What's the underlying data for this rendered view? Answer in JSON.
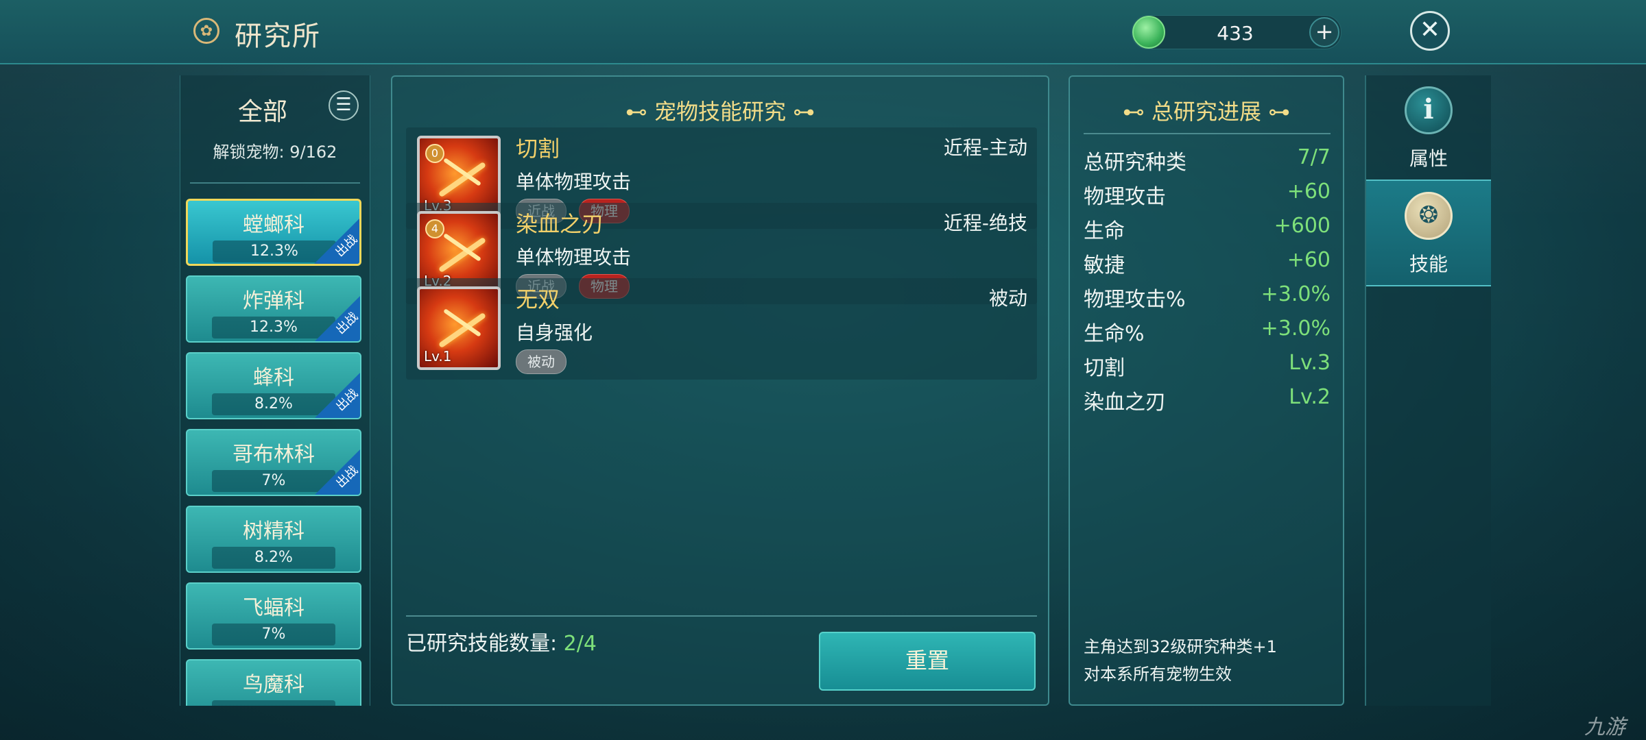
{
  "header": {
    "title": "研究所",
    "title_icon": "emblem-icon",
    "currency_value": "433",
    "plus_label": "+",
    "close_label": "✕"
  },
  "sidebar": {
    "filter_label": "全部",
    "menu_label": "☰",
    "unlock_text": "解锁宠物: 9/162",
    "categories": [
      {
        "name": "螳螂科",
        "percent": "12.3%",
        "badge": "出战",
        "selected": true
      },
      {
        "name": "炸弹科",
        "percent": "12.3%",
        "badge": "出战"
      },
      {
        "name": "蜂科",
        "percent": "8.2%",
        "badge": "出战"
      },
      {
        "name": "哥布林科",
        "percent": "7%",
        "badge": "出战"
      },
      {
        "name": "树精科",
        "percent": "8.2%"
      },
      {
        "name": "飞蝠科",
        "percent": "7%"
      },
      {
        "name": "鸟魔科",
        "percent": ""
      }
    ]
  },
  "center": {
    "title": "宠物技能研究",
    "skills": [
      {
        "name": "切割",
        "type": "近程-主动",
        "desc": "单体物理攻击",
        "level": "Lv.3",
        "num": "0",
        "tags": [
          "近战",
          "物理"
        ]
      },
      {
        "name": "染血之刃",
        "type": "近程-绝技",
        "desc": "单体物理攻击",
        "level": "Lv.2",
        "num": "4",
        "tags": [
          "近战",
          "物理"
        ]
      },
      {
        "name": "无双",
        "type": "被动",
        "desc": "自身强化",
        "level": "Lv.1",
        "num": "",
        "tags": [
          "被动"
        ]
      }
    ],
    "count_label": "已研究技能数量: ",
    "count_value": "2/4",
    "reset_label": "重置"
  },
  "progress": {
    "title": "总研究进展",
    "stats": [
      {
        "label": "总研究种类",
        "value": "7/7"
      },
      {
        "label": "物理攻击",
        "value": "+60"
      },
      {
        "label": "生命",
        "value": "+600"
      },
      {
        "label": "敏捷",
        "value": "+60"
      },
      {
        "label": "物理攻击%",
        "value": "+3.0%"
      },
      {
        "label": "生命%",
        "value": "+3.0%"
      },
      {
        "label": "切割",
        "value": "Lv.3"
      },
      {
        "label": "染血之刃",
        "value": "Lv.2"
      }
    ],
    "note_1": "主角达到32级研究种类+1",
    "note_2": "对本系所有宠物生效"
  },
  "tabs": [
    {
      "label": "属性",
      "icon": "info-icon",
      "glyph": "i"
    },
    {
      "label": "技能",
      "icon": "skill-icon",
      "glyph": "❂",
      "active": true
    }
  ],
  "watermark": "九游",
  "colors": {
    "accent_gold": "#f2dc88",
    "value_green": "#7ee07a",
    "tag_red": "#b8231f",
    "selected_border": "#f0d85a"
  }
}
